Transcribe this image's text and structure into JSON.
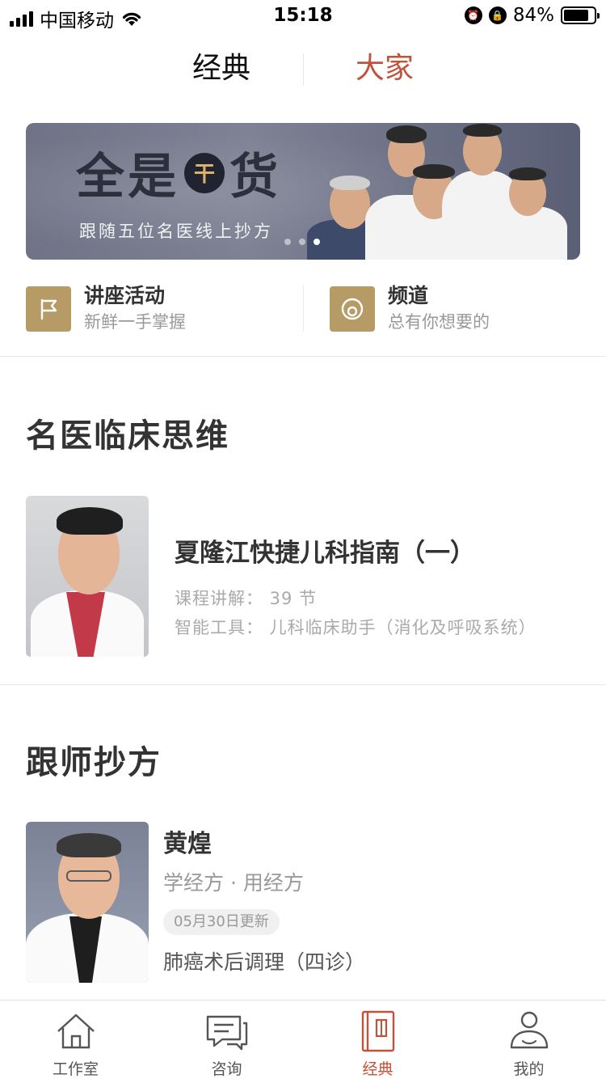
{
  "status_bar": {
    "carrier": "中国移动",
    "time": "15:18",
    "battery_percent": "84%",
    "battery_level": 0.84
  },
  "top_tabs": [
    {
      "label": "经典",
      "active": false
    },
    {
      "label": "大家",
      "active": true
    }
  ],
  "banner": {
    "title_a": "全是",
    "title_badge": "干",
    "title_b": "货",
    "subtitle": "跟随五位名医线上抄方",
    "slide_count": 3,
    "active_slide": 3
  },
  "quick_entries": [
    {
      "title": "讲座活动",
      "subtitle": "新鲜一手掌握",
      "icon": "flag-icon"
    },
    {
      "title": "频道",
      "subtitle": "总有你想要的",
      "icon": "channel-icon"
    }
  ],
  "section_thinking": {
    "title": "名医临床思维",
    "course": {
      "title": "夏隆江快捷儿科指南（一）",
      "meta_1": "课程讲解：  39 节",
      "meta_2": "智能工具：  儿科临床助手（消化及呼吸系统）"
    }
  },
  "section_follow": {
    "title": "跟师抄方",
    "teacher": {
      "name": "黄煌",
      "tagline": "学经方 · 用经方",
      "update": "05月30日更新",
      "course": "肺癌术后调理（四诊）"
    }
  },
  "bottom_nav": [
    {
      "label": "工作室",
      "icon": "home-icon",
      "active": false
    },
    {
      "label": "咨询",
      "icon": "chat-icon",
      "active": false
    },
    {
      "label": "经典",
      "icon": "book-icon",
      "active": true
    },
    {
      "label": "我的",
      "icon": "user-icon",
      "active": false
    }
  ],
  "colors": {
    "accent": "#c0533a",
    "gold": "#b79b66",
    "text": "#333333",
    "muted": "#999999"
  }
}
